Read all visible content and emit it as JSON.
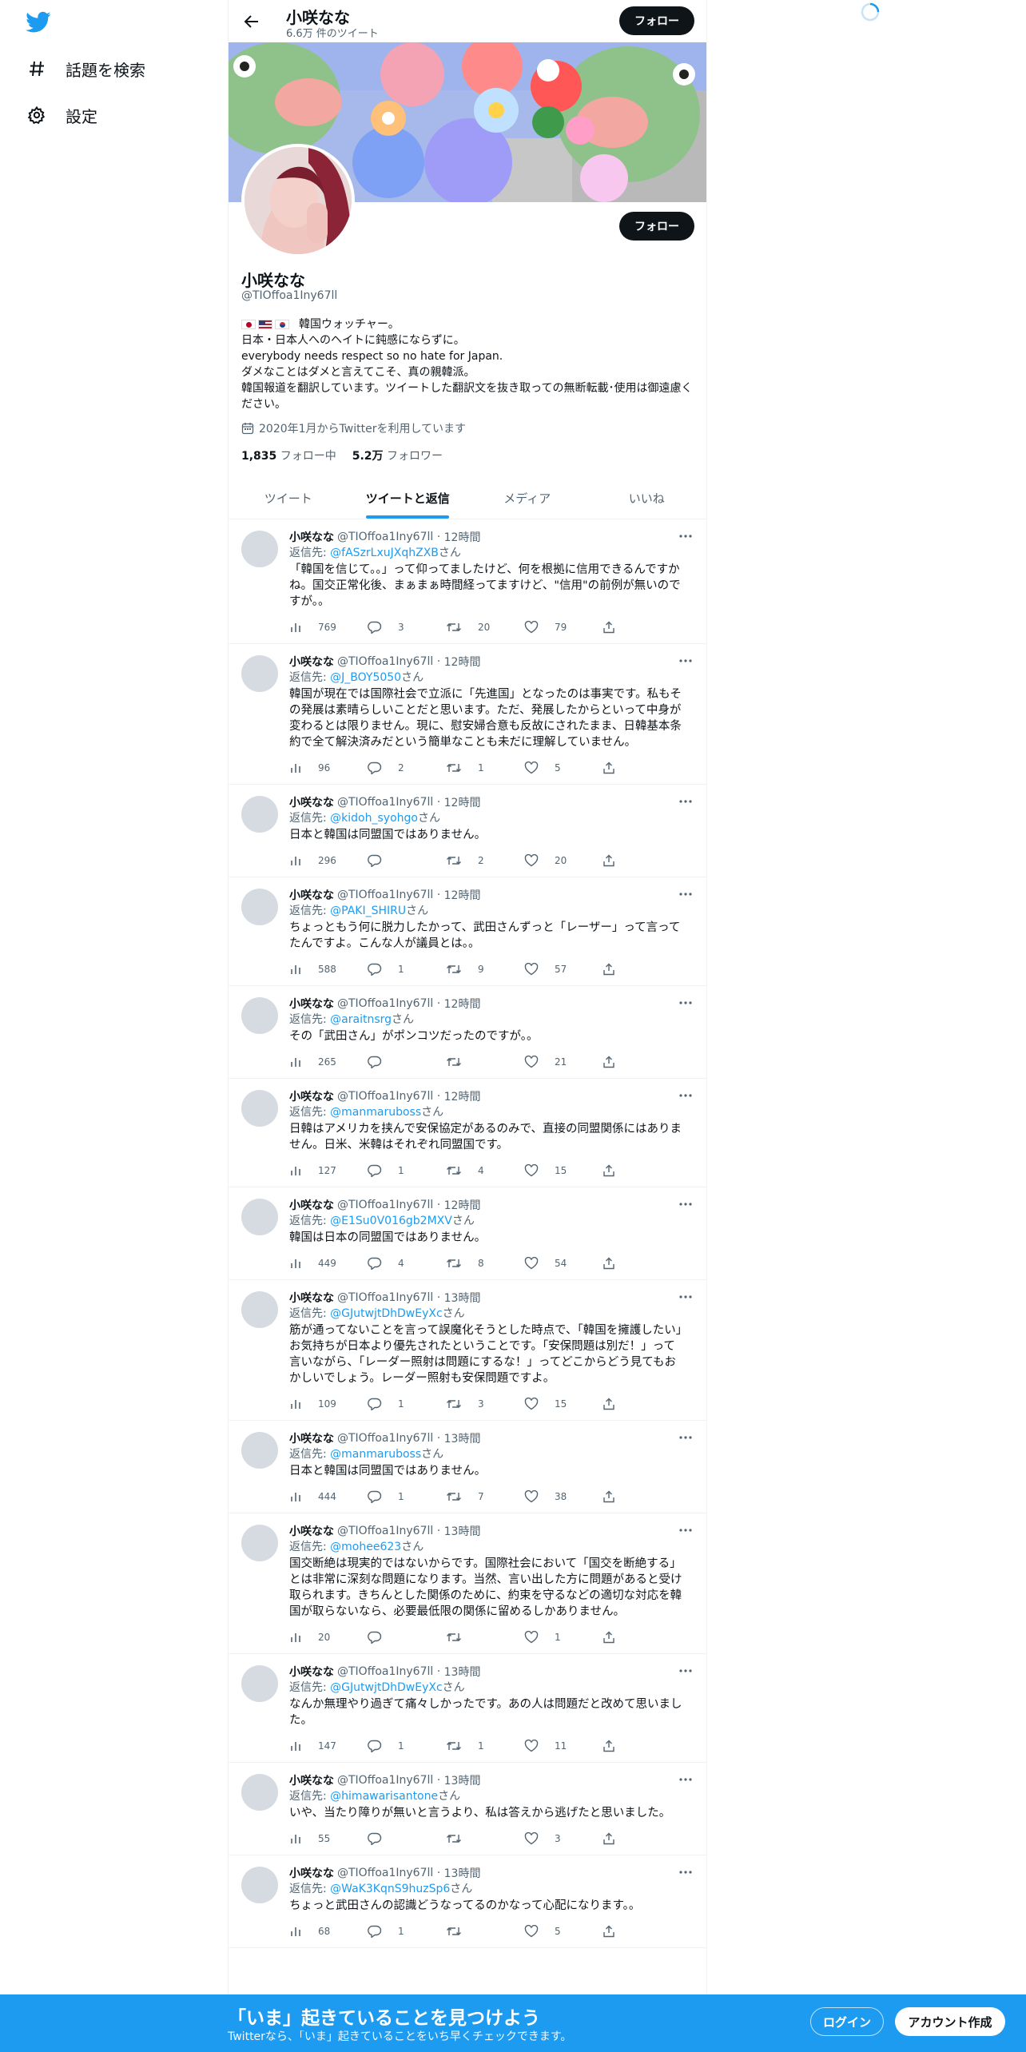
{
  "nav": {
    "items": [
      {
        "label": "話題を検索",
        "icon": "hashtag-icon"
      },
      {
        "label": "設定",
        "icon": "gear-icon"
      }
    ]
  },
  "header": {
    "name": "小咲なな",
    "tweet_count": "6.6万 件のツイート",
    "follow_label": "フォロー"
  },
  "profile": {
    "follow_label": "フォロー",
    "name": "小咲なな",
    "handle": "@TIOffoa1Iny67ll",
    "bio_first": "韓国ウォッチャー。",
    "bio_lines": [
      "日本・日本人へのヘイトに鈍感にならずに。",
      "everybody needs respect so no hate for Japan.",
      "ダメなことはダメと言えてこそ、真の親韓派。",
      "韓国報道を翻訳しています。ツイートした翻訳文を抜き取っての無断転載･使用は御遠慮ください。"
    ],
    "joined": "2020年1月からTwitterを利用しています",
    "following_count": "1,835",
    "following_label": "フォロー中",
    "followers_count": "5.2万",
    "followers_label": "フォロワー"
  },
  "tabs": [
    {
      "label": "ツイート",
      "active": false
    },
    {
      "label": "ツイートと返信",
      "active": true
    },
    {
      "label": "メディア",
      "active": false
    },
    {
      "label": "いいね",
      "active": false
    }
  ],
  "tweets": [
    {
      "name": "小咲なな",
      "handle": "@TIOffoa1Iny67ll",
      "time": "12時間",
      "reply_to": "@fASzrLxuJXqhZXB",
      "text": "「韓国を信じて。。」って仰ってましたけど、何を根拠に信用できるんですかね。国交正常化後、まぁまぁ時間経ってますけど、\"信用\"の前例が無いのですが。。",
      "views": "769",
      "replies": "3",
      "retweets": "20",
      "likes": "79"
    },
    {
      "name": "小咲なな",
      "handle": "@TIOffoa1Iny67ll",
      "time": "12時間",
      "reply_to": "@J_BOY5050",
      "text": "韓国が現在では国際社会で立派に「先進国」となったのは事実です。私もその発展は素晴らしいことだと思います。ただ、発展したからといって中身が変わるとは限りません。現に、慰安婦合意も反故にされたまま、日韓基本条約で全て解決済みだという簡単なことも未だに理解していません。",
      "views": "96",
      "replies": "2",
      "retweets": "1",
      "likes": "5"
    },
    {
      "name": "小咲なな",
      "handle": "@TIOffoa1Iny67ll",
      "time": "12時間",
      "reply_to": "@kidoh_syohgo",
      "text": "日本と韓国は同盟国ではありません。",
      "views": "296",
      "replies": "",
      "retweets": "2",
      "likes": "20"
    },
    {
      "name": "小咲なな",
      "handle": "@TIOffoa1Iny67ll",
      "time": "12時間",
      "reply_to": "@PAKI_SHIRU",
      "text": "ちょっともう何に脱力したかって、武田さんずっと「レーザー」って言ってたんですよ。こんな人が議員とは。。",
      "views": "588",
      "replies": "1",
      "retweets": "9",
      "likes": "57"
    },
    {
      "name": "小咲なな",
      "handle": "@TIOffoa1Iny67ll",
      "time": "12時間",
      "reply_to": "@araitnsrg",
      "text": "その「武田さん」がポンコツだったのですが。。",
      "views": "265",
      "replies": "",
      "retweets": "",
      "likes": "21"
    },
    {
      "name": "小咲なな",
      "handle": "@TIOffoa1Iny67ll",
      "time": "12時間",
      "reply_to": "@manmaruboss",
      "text": "日韓はアメリカを挟んで安保協定があるのみで、直接の同盟関係にはありません。日米、米韓はそれぞれ同盟国です。",
      "views": "127",
      "replies": "1",
      "retweets": "4",
      "likes": "15"
    },
    {
      "name": "小咲なな",
      "handle": "@TIOffoa1Iny67ll",
      "time": "12時間",
      "reply_to": "@E1Su0V016gb2MXV",
      "text": "韓国は日本の同盟国ではありません。",
      "views": "449",
      "replies": "4",
      "retweets": "8",
      "likes": "54"
    },
    {
      "name": "小咲なな",
      "handle": "@TIOffoa1Iny67ll",
      "time": "13時間",
      "reply_to": "@GJutwjtDhDwEyXc",
      "text": "筋が通ってないことを言って誤魔化そうとした時点で、「韓国を擁護したい」お気持ちが日本より優先されたということです。「安保問題は別だ！」って言いながら、「レーダー照射は問題にするな！」ってどこからどう見てもおかしいでしょう。レーダー照射も安保問題ですよ。",
      "views": "109",
      "replies": "1",
      "retweets": "3",
      "likes": "15"
    },
    {
      "name": "小咲なな",
      "handle": "@TIOffoa1Iny67ll",
      "time": "13時間",
      "reply_to": "@manmaruboss",
      "text": "日本と韓国は同盟国ではありません。",
      "views": "444",
      "replies": "1",
      "retweets": "7",
      "likes": "38"
    },
    {
      "name": "小咲なな",
      "handle": "@TIOffoa1Iny67ll",
      "time": "13時間",
      "reply_to": "@mohee623",
      "text": "国交断絶は現実的ではないからです。国際社会において「国交を断絶する」とは非常に深刻な問題になります。当然、言い出した方に問題があると受け取られます。きちんとした関係のために、約束を守るなどの適切な対応を韓国が取らないなら、必要最低限の関係に留めるしかありません。",
      "views": "20",
      "replies": "",
      "retweets": "",
      "likes": "1"
    },
    {
      "name": "小咲なな",
      "handle": "@TIOffoa1Iny67ll",
      "time": "13時間",
      "reply_to": "@GJutwjtDhDwEyXc",
      "text": "なんか無理やり過ぎて痛々しかったです。あの人は問題だと改めて思いました。",
      "views": "147",
      "replies": "1",
      "retweets": "1",
      "likes": "11"
    },
    {
      "name": "小咲なな",
      "handle": "@TIOffoa1Iny67ll",
      "time": "13時間",
      "reply_to": "@himawarisantone",
      "text": "いや、当たり障りが無いと言うより、私は答えから逃げたと思いました。",
      "views": "55",
      "replies": "",
      "retweets": "",
      "likes": "3"
    },
    {
      "name": "小咲なな",
      "handle": "@TIOffoa1Iny67ll",
      "time": "13時間",
      "reply_to": "@WaK3KqnS9huzSp6",
      "text": "ちょっと武田さんの認識どうなってるのかなって心配になります。。",
      "views": "68",
      "replies": "1",
      "retweets": "",
      "likes": "5"
    }
  ],
  "reply_prefix": "返信先: ",
  "reply_suffix": "さん",
  "bottom_bar": {
    "title": "「いま」起きていることを見つけよう",
    "subtitle": "Twitterなら、「いま」起きていることをいち早くチェックできます。",
    "login_label": "ログイン",
    "signup_label": "アカウント作成"
  },
  "colors": {
    "accent": "#1d9bf0",
    "text": "#0f1419",
    "secondary": "#536471"
  }
}
